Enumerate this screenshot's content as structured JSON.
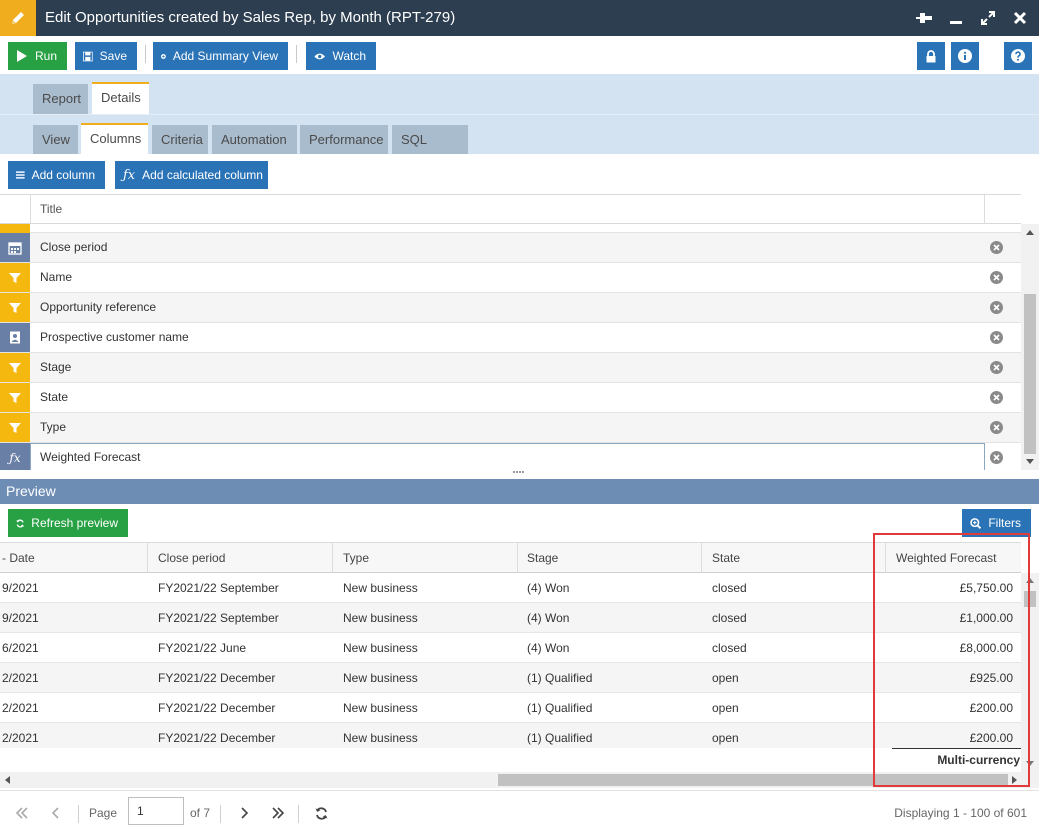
{
  "window": {
    "title": "Edit Opportunities created by Sales Rep, by Month (RPT-279)",
    "icons": [
      "pin-icon",
      "minimize-icon",
      "maximize-icon",
      "close-icon"
    ]
  },
  "toolbar": {
    "run_label": "Run",
    "save_label": "Save",
    "add_summary_label": "Add Summary View",
    "watch_label": "Watch",
    "right_icons": [
      "lock-icon",
      "info-icon",
      "help-icon"
    ]
  },
  "tabs_top": [
    {
      "label": "Report",
      "active": false
    },
    {
      "label": "Details",
      "active": true
    }
  ],
  "tabs_sub": [
    {
      "label": "View",
      "active": false
    },
    {
      "label": "Columns",
      "active": true
    },
    {
      "label": "Criteria",
      "active": false
    },
    {
      "label": "Automation",
      "active": false
    },
    {
      "label": "Performance",
      "active": false
    },
    {
      "label": "SQL Query",
      "active": false
    }
  ],
  "column_actions": {
    "add_column_label": "Add column",
    "add_calculated_label": "Add calculated column"
  },
  "column_grid": {
    "header_title": "Title",
    "rows": [
      {
        "label": "Close period",
        "icon": "calendar-icon",
        "color": "slate"
      },
      {
        "label": "Name",
        "icon": "filter-icon",
        "color": "yellow"
      },
      {
        "label": "Opportunity reference",
        "icon": "filter-icon",
        "color": "yellow"
      },
      {
        "label": "Prospective customer name",
        "icon": "contact-card-icon",
        "color": "slate"
      },
      {
        "label": "Stage",
        "icon": "filter-icon",
        "color": "yellow"
      },
      {
        "label": "State",
        "icon": "filter-icon",
        "color": "yellow"
      },
      {
        "label": "Type",
        "icon": "filter-icon",
        "color": "yellow"
      },
      {
        "label": "Weighted Forecast",
        "icon": "function-icon",
        "color": "slate",
        "selected": true
      }
    ]
  },
  "preview": {
    "title": "Preview",
    "refresh_label": "Refresh preview",
    "filters_label": "Filters",
    "headers": [
      "- Date",
      "Close period",
      "Type",
      "Stage",
      "State",
      "Weighted Forecast"
    ],
    "rows": [
      [
        "9/2021",
        "FY2021/22 September",
        "New business",
        "(4) Won",
        "closed",
        "£5,750.00"
      ],
      [
        "9/2021",
        "FY2021/22 September",
        "New business",
        "(4) Won",
        "closed",
        "£1,000.00"
      ],
      [
        "6/2021",
        "FY2021/22 June",
        "New business",
        "(4) Won",
        "closed",
        "£8,000.00"
      ],
      [
        "2/2021",
        "FY2021/22 December",
        "New business",
        "(1) Qualified",
        "open",
        "£925.00"
      ],
      [
        "2/2021",
        "FY2021/22 December",
        "New business",
        "(1) Qualified",
        "open",
        "£200.00"
      ],
      [
        "2/2021",
        "FY2021/22 December",
        "New business",
        "(1) Qualified",
        "open",
        "£200.00"
      ]
    ],
    "summary_label": "Multi-currency"
  },
  "pager": {
    "page_label": "Page",
    "page_value": "1",
    "of_label": "of 7",
    "display_text": "Displaying 1 - 100 of 601"
  },
  "colors": {
    "titlebar": "#2d3e50",
    "accent_yellow": "#f0ad1d",
    "button_blue": "#2a73b7",
    "button_green": "#27a143",
    "tab_strip": "#d3e3f1",
    "preview_bar": "#6e8db5",
    "highlight_red": "#e03b3b"
  }
}
